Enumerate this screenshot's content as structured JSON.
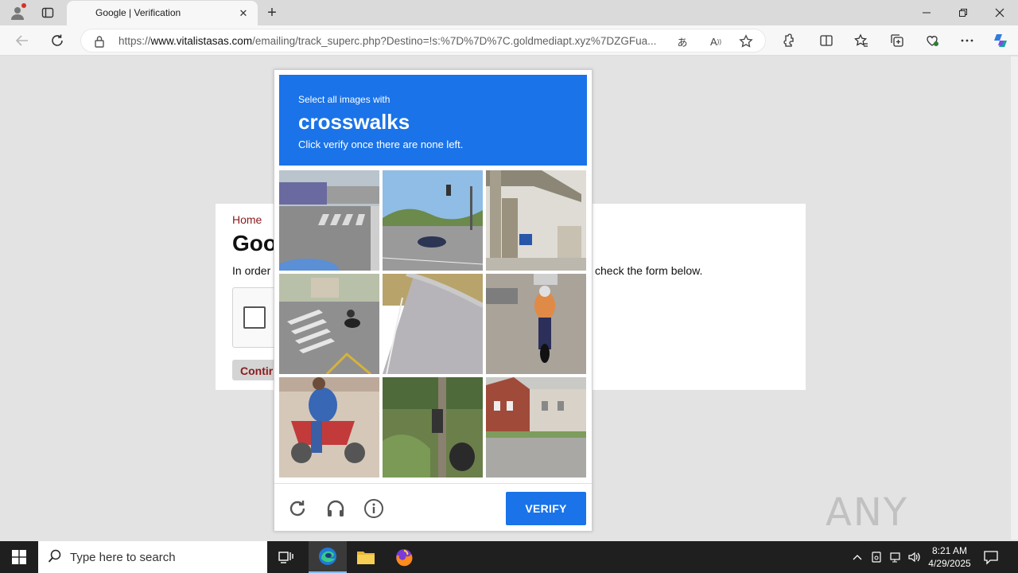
{
  "browser": {
    "tab_title": "Google | Verification",
    "url_scheme": "https://",
    "url_host": "www.vitalistasas.com",
    "url_path": "/emailing/track_superc.php?Destino=!s:%7D%7D%7C.goldmediapt.xyz%7DZGFua...",
    "window_controls": [
      "minimize",
      "maximize",
      "close"
    ]
  },
  "page": {
    "breadcrumb": "Home",
    "heading": "Goo",
    "description_start": "In order",
    "description_end": "check the form below.",
    "continue_label": "Contir"
  },
  "challenge": {
    "prompt": "Select all images with",
    "target": "crosswalks",
    "instruction": "Click verify once there are none left.",
    "tiles": [
      {
        "index": 1,
        "scene": "street with crosswalk"
      },
      {
        "index": 2,
        "scene": "road with traffic light and car"
      },
      {
        "index": 3,
        "scene": "overpass with street sign"
      },
      {
        "index": 4,
        "scene": "intersection with crosswalk and motorcycle"
      },
      {
        "index": 5,
        "scene": "empty road with guardrail"
      },
      {
        "index": 6,
        "scene": "motorcycle rider on road"
      },
      {
        "index": 7,
        "scene": "person on red scooter"
      },
      {
        "index": 8,
        "scene": "motorcycle in grass"
      },
      {
        "index": 9,
        "scene": "brick building street"
      }
    ],
    "verify_label": "VERIFY",
    "footer_icons": [
      "reload-icon",
      "headphones-icon",
      "info-icon"
    ]
  },
  "watermark": "ANY RUN",
  "taskbar": {
    "search_placeholder": "Type here to search",
    "time": "8:21 AM",
    "date": "4/29/2025"
  },
  "colors": {
    "challenge_blue": "#1a73e8",
    "link_red": "#8b1a1a",
    "taskbar": "#1f1f1f"
  }
}
